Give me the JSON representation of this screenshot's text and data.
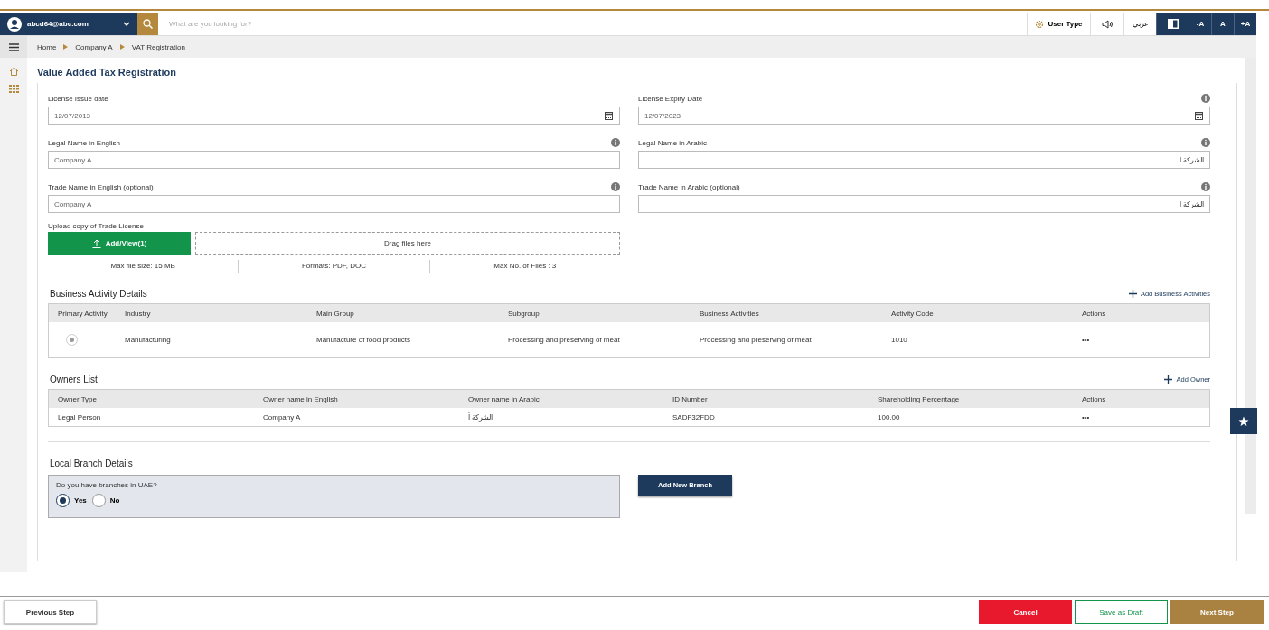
{
  "header": {
    "user": "abcd64@abc.com",
    "search": {
      "placeholder": "What are you looking for?"
    },
    "user_type": "User Type",
    "language": "عربي",
    "font_buttons": [
      "-A",
      "A",
      "+A"
    ]
  },
  "breadcrumb": [
    {
      "label": "Home",
      "link": true
    },
    {
      "label": "Company A",
      "link": true
    },
    {
      "label": "VAT Registration",
      "link": false
    }
  ],
  "page_title": "Value Added Tax Registration",
  "fields": [
    {
      "label": "License Issue date",
      "value": "12/07/2013",
      "kind": "date",
      "info": false,
      "rtl": false
    },
    {
      "label": "License Expiry Date",
      "value": "12/07/2023",
      "kind": "date",
      "info": true,
      "rtl": false
    },
    {
      "label": "Legal Name in English",
      "value": "Company A",
      "kind": "text",
      "info": true,
      "rtl": false
    },
    {
      "label": "Legal Name in Arabic",
      "value": "الشركة أ",
      "kind": "text",
      "info": true,
      "rtl": true
    },
    {
      "label": "Trade Name in English (optional)",
      "value": "Company A",
      "kind": "text",
      "info": true,
      "rtl": false
    },
    {
      "label": "Trade Name in Arabic (optional)",
      "value": "الشركة أ",
      "kind": "text",
      "info": true,
      "rtl": true
    }
  ],
  "upload": {
    "label": "Upload copy of Trade License",
    "button": "Add/View(1)",
    "dropzone": "Drag files here",
    "notes": [
      "Max file size: 15 MB",
      "Formats: PDF, DOC",
      "Max No. of Files : 3"
    ]
  },
  "business": {
    "title": "Business Activity Details",
    "add_action": "Add Business Activities",
    "columns": [
      "Primary Activity",
      "Industry",
      "Main Group",
      "Subgroup",
      "Business Activities",
      "Activity Code",
      "Actions"
    ],
    "rows": [
      {
        "selected": true,
        "cells": [
          "",
          "Manufacturing",
          "Manufacture of food products",
          "Processing and preserving of meat",
          "Processing and preserving of meat",
          "1010",
          "•••"
        ]
      }
    ]
  },
  "owners": {
    "title": "Owners List",
    "add_action": "Add Owner",
    "columns": [
      "Owner Type",
      "Owner name in English",
      "Owner name in Arabic",
      "ID Number",
      "Shareholding Percentage",
      "Actions"
    ],
    "rows": [
      {
        "cells": [
          "Legal Person",
          "Company A",
          "الشركة أ",
          "SADF32FDD",
          "100.00",
          "•••"
        ]
      }
    ]
  },
  "branch": {
    "title": "Local Branch Details",
    "question": "Do you have branches in UAE?",
    "options": [
      {
        "label": "Yes",
        "selected": true
      },
      {
        "label": "No",
        "selected": false
      }
    ],
    "button": "Add New Branch"
  },
  "footer": [
    {
      "label": "Previous Step",
      "kind": "previous"
    },
    {
      "label": "Cancel",
      "kind": "cancel"
    },
    {
      "label": "Save as Draft",
      "kind": "draft"
    },
    {
      "label": "Next Step",
      "kind": "next"
    }
  ]
}
